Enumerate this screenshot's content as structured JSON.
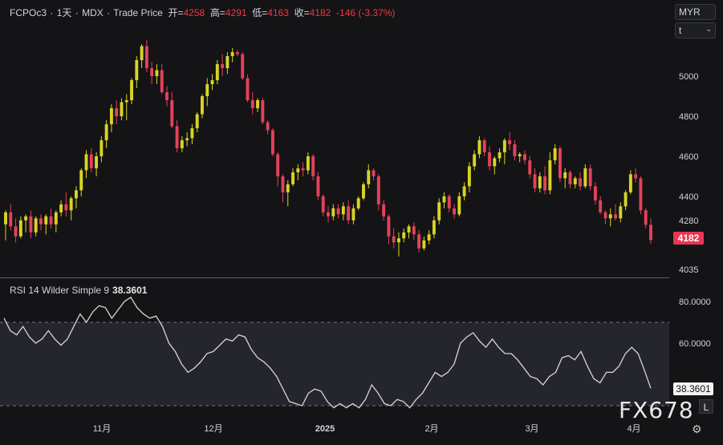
{
  "header": {
    "symbol": "FCPOc3",
    "interval": "1天",
    "exchange": "MDX",
    "price_type": "Trade Price",
    "open_label": "开=",
    "open": "4258",
    "high_label": "高=",
    "high": "4291",
    "low_label": "低=",
    "low": "4163",
    "close_label": "收=",
    "close": "4182",
    "change": "-146 (-3.37%)"
  },
  "controls": {
    "currency": "MYR",
    "unit": "t"
  },
  "price_badge": "4182",
  "rsi": {
    "label": "RSI 14 Wilder Simple 9",
    "value": "38.3601"
  },
  "watermark": "FX678",
  "log_button": "L",
  "colors": {
    "up": "#d8d522",
    "down": "#e5415b",
    "background": "#141416",
    "rsi_line": "#d5d5d5",
    "rsi_band": "#25252e"
  },
  "chart_data": [
    {
      "type": "candlestick",
      "yticks": [
        4035,
        4280,
        4400,
        4600,
        4800,
        5000
      ],
      "ylim": [
        4030,
        5250
      ],
      "xlabels": [
        "11月",
        "12月",
        "2025",
        "2月",
        "3月",
        "4月"
      ],
      "candles": [
        [
          4260,
          4330,
          4180,
          4320
        ],
        [
          4320,
          4360,
          4230,
          4250
        ],
        [
          4250,
          4290,
          4170,
          4200
        ],
        [
          4200,
          4300,
          4190,
          4280
        ],
        [
          4280,
          4310,
          4220,
          4300
        ],
        [
          4300,
          4330,
          4190,
          4220
        ],
        [
          4220,
          4300,
          4200,
          4290
        ],
        [
          4290,
          4310,
          4230,
          4260
        ],
        [
          4260,
          4310,
          4210,
          4300
        ],
        [
          4300,
          4340,
          4240,
          4260
        ],
        [
          4260,
          4330,
          4220,
          4320
        ],
        [
          4320,
          4380,
          4300,
          4360
        ],
        [
          4360,
          4420,
          4300,
          4330
        ],
        [
          4330,
          4400,
          4280,
          4390
        ],
        [
          4390,
          4450,
          4340,
          4430
        ],
        [
          4430,
          4540,
          4400,
          4530
        ],
        [
          4530,
          4630,
          4490,
          4610
        ],
        [
          4610,
          4640,
          4520,
          4540
        ],
        [
          4540,
          4620,
          4500,
          4600
        ],
        [
          4600,
          4700,
          4570,
          4680
        ],
        [
          4680,
          4780,
          4640,
          4760
        ],
        [
          4760,
          4860,
          4720,
          4840
        ],
        [
          4840,
          4880,
          4760,
          4800
        ],
        [
          4800,
          4890,
          4780,
          4870
        ],
        [
          4870,
          4910,
          4780,
          4880
        ],
        [
          4880,
          4990,
          4860,
          4980
        ],
        [
          4980,
          5100,
          4940,
          5080
        ],
        [
          5080,
          5160,
          5040,
          5150
        ],
        [
          5150,
          5180,
          5020,
          5040
        ],
        [
          5040,
          5070,
          4960,
          5000
        ],
        [
          5000,
          5060,
          4960,
          5030
        ],
        [
          5030,
          5060,
          4910,
          4920
        ],
        [
          4920,
          4950,
          4850,
          4880
        ],
        [
          4880,
          4920,
          4740,
          4750
        ],
        [
          4750,
          4780,
          4620,
          4640
        ],
        [
          4640,
          4700,
          4620,
          4680
        ],
        [
          4680,
          4720,
          4650,
          4690
        ],
        [
          4690,
          4760,
          4660,
          4740
        ],
        [
          4740,
          4820,
          4720,
          4810
        ],
        [
          4810,
          4910,
          4790,
          4900
        ],
        [
          4900,
          4990,
          4850,
          4960
        ],
        [
          4960,
          5010,
          4930,
          4980
        ],
        [
          4980,
          5080,
          4960,
          5060
        ],
        [
          5060,
          5110,
          5000,
          5040
        ],
        [
          5040,
          5120,
          5010,
          5100
        ],
        [
          5100,
          5140,
          5070,
          5120
        ],
        [
          5120,
          5130,
          5100,
          5110
        ],
        [
          5110,
          5120,
          4980,
          4990
        ],
        [
          4990,
          5010,
          4870,
          4880
        ],
        [
          4880,
          4920,
          4810,
          4840
        ],
        [
          4840,
          4890,
          4820,
          4880
        ],
        [
          4880,
          4890,
          4760,
          4770
        ],
        [
          4770,
          4780,
          4710,
          4730
        ],
        [
          4730,
          4740,
          4600,
          4610
        ],
        [
          4610,
          4620,
          4450,
          4500
        ],
        [
          4500,
          4510,
          4370,
          4420
        ],
        [
          4420,
          4480,
          4350,
          4460
        ],
        [
          4460,
          4540,
          4450,
          4520
        ],
        [
          4520,
          4560,
          4480,
          4540
        ],
        [
          4540,
          4570,
          4500,
          4530
        ],
        [
          4530,
          4620,
          4510,
          4600
        ],
        [
          4600,
          4610,
          4480,
          4500
        ],
        [
          4500,
          4520,
          4380,
          4400
        ],
        [
          4400,
          4410,
          4300,
          4320
        ],
        [
          4320,
          4350,
          4270,
          4300
        ],
        [
          4300,
          4360,
          4280,
          4340
        ],
        [
          4340,
          4360,
          4290,
          4310
        ],
        [
          4310,
          4370,
          4280,
          4350
        ],
        [
          4350,
          4380,
          4260,
          4280
        ],
        [
          4280,
          4360,
          4260,
          4340
        ],
        [
          4340,
          4400,
          4330,
          4390
        ],
        [
          4390,
          4470,
          4380,
          4460
        ],
        [
          4460,
          4560,
          4440,
          4530
        ],
        [
          4530,
          4540,
          4480,
          4500
        ],
        [
          4500,
          4510,
          4330,
          4360
        ],
        [
          4360,
          4380,
          4280,
          4300
        ],
        [
          4300,
          4310,
          4160,
          4200
        ],
        [
          4200,
          4240,
          4140,
          4170
        ],
        [
          4170,
          4220,
          4100,
          4190
        ],
        [
          4190,
          4240,
          4170,
          4220
        ],
        [
          4220,
          4260,
          4190,
          4250
        ],
        [
          4250,
          4270,
          4180,
          4210
        ],
        [
          4210,
          4230,
          4120,
          4140
        ],
        [
          4140,
          4200,
          4130,
          4180
        ],
        [
          4180,
          4230,
          4160,
          4210
        ],
        [
          4210,
          4300,
          4190,
          4280
        ],
        [
          4280,
          4390,
          4260,
          4370
        ],
        [
          4370,
          4420,
          4340,
          4400
        ],
        [
          4400,
          4410,
          4320,
          4340
        ],
        [
          4340,
          4360,
          4290,
          4310
        ],
        [
          4310,
          4420,
          4300,
          4400
        ],
        [
          4400,
          4470,
          4380,
          4450
        ],
        [
          4450,
          4570,
          4420,
          4550
        ],
        [
          4550,
          4630,
          4530,
          4610
        ],
        [
          4610,
          4700,
          4590,
          4680
        ],
        [
          4680,
          4690,
          4600,
          4620
        ],
        [
          4620,
          4650,
          4530,
          4550
        ],
        [
          4550,
          4600,
          4510,
          4590
        ],
        [
          4590,
          4640,
          4570,
          4620
        ],
        [
          4620,
          4690,
          4560,
          4680
        ],
        [
          4680,
          4720,
          4630,
          4660
        ],
        [
          4660,
          4680,
          4580,
          4600
        ],
        [
          4600,
          4620,
          4570,
          4610
        ],
        [
          4610,
          4630,
          4560,
          4580
        ],
        [
          4580,
          4600,
          4490,
          4510
        ],
        [
          4510,
          4540,
          4420,
          4440
        ],
        [
          4440,
          4520,
          4420,
          4500
        ],
        [
          4500,
          4550,
          4410,
          4430
        ],
        [
          4430,
          4620,
          4410,
          4580
        ],
        [
          4580,
          4660,
          4560,
          4640
        ],
        [
          4640,
          4650,
          4470,
          4490
        ],
        [
          4490,
          4540,
          4440,
          4520
        ],
        [
          4520,
          4530,
          4440,
          4460
        ],
        [
          4460,
          4500,
          4440,
          4490
        ],
        [
          4490,
          4520,
          4430,
          4450
        ],
        [
          4450,
          4560,
          4440,
          4540
        ],
        [
          4540,
          4560,
          4430,
          4450
        ],
        [
          4450,
          4470,
          4360,
          4380
        ],
        [
          4380,
          4400,
          4310,
          4320
        ],
        [
          4320,
          4330,
          4260,
          4290
        ],
        [
          4290,
          4340,
          4250,
          4310
        ],
        [
          4310,
          4360,
          4280,
          4290
        ],
        [
          4290,
          4370,
          4270,
          4350
        ],
        [
          4350,
          4430,
          4330,
          4420
        ],
        [
          4420,
          4530,
          4410,
          4510
        ],
        [
          4510,
          4540,
          4470,
          4490
        ],
        [
          4490,
          4500,
          4310,
          4330
        ],
        [
          4330,
          4340,
          4240,
          4258
        ],
        [
          4258,
          4291,
          4163,
          4182
        ]
      ]
    },
    {
      "type": "line",
      "name": "RSI 14 Wilder Simple 9",
      "yticks": [
        60,
        80
      ],
      "ylim": [
        25,
        86
      ],
      "band": [
        30,
        70
      ],
      "values": [
        72,
        66,
        64,
        68,
        63,
        60,
        62,
        66,
        62,
        59,
        62,
        68,
        74,
        70,
        75,
        78,
        77,
        72,
        76,
        80,
        82,
        77,
        74,
        72,
        73,
        68,
        60,
        56,
        50,
        46,
        48,
        51,
        55,
        56,
        59,
        62,
        61,
        64,
        63,
        57,
        53,
        51,
        48,
        44,
        38,
        32,
        31,
        30,
        36,
        38,
        37,
        32,
        29,
        31,
        29,
        31,
        29,
        33,
        40,
        36,
        31,
        30,
        33,
        32,
        29,
        33,
        36,
        41,
        46,
        44,
        46,
        50,
        60,
        63,
        65,
        61,
        58,
        62,
        58,
        55,
        55,
        52,
        48,
        44,
        43,
        40,
        44,
        46,
        53,
        54,
        52,
        56,
        49,
        43,
        41,
        46,
        46,
        49,
        55,
        58,
        55,
        47,
        38.3601
      ]
    }
  ]
}
